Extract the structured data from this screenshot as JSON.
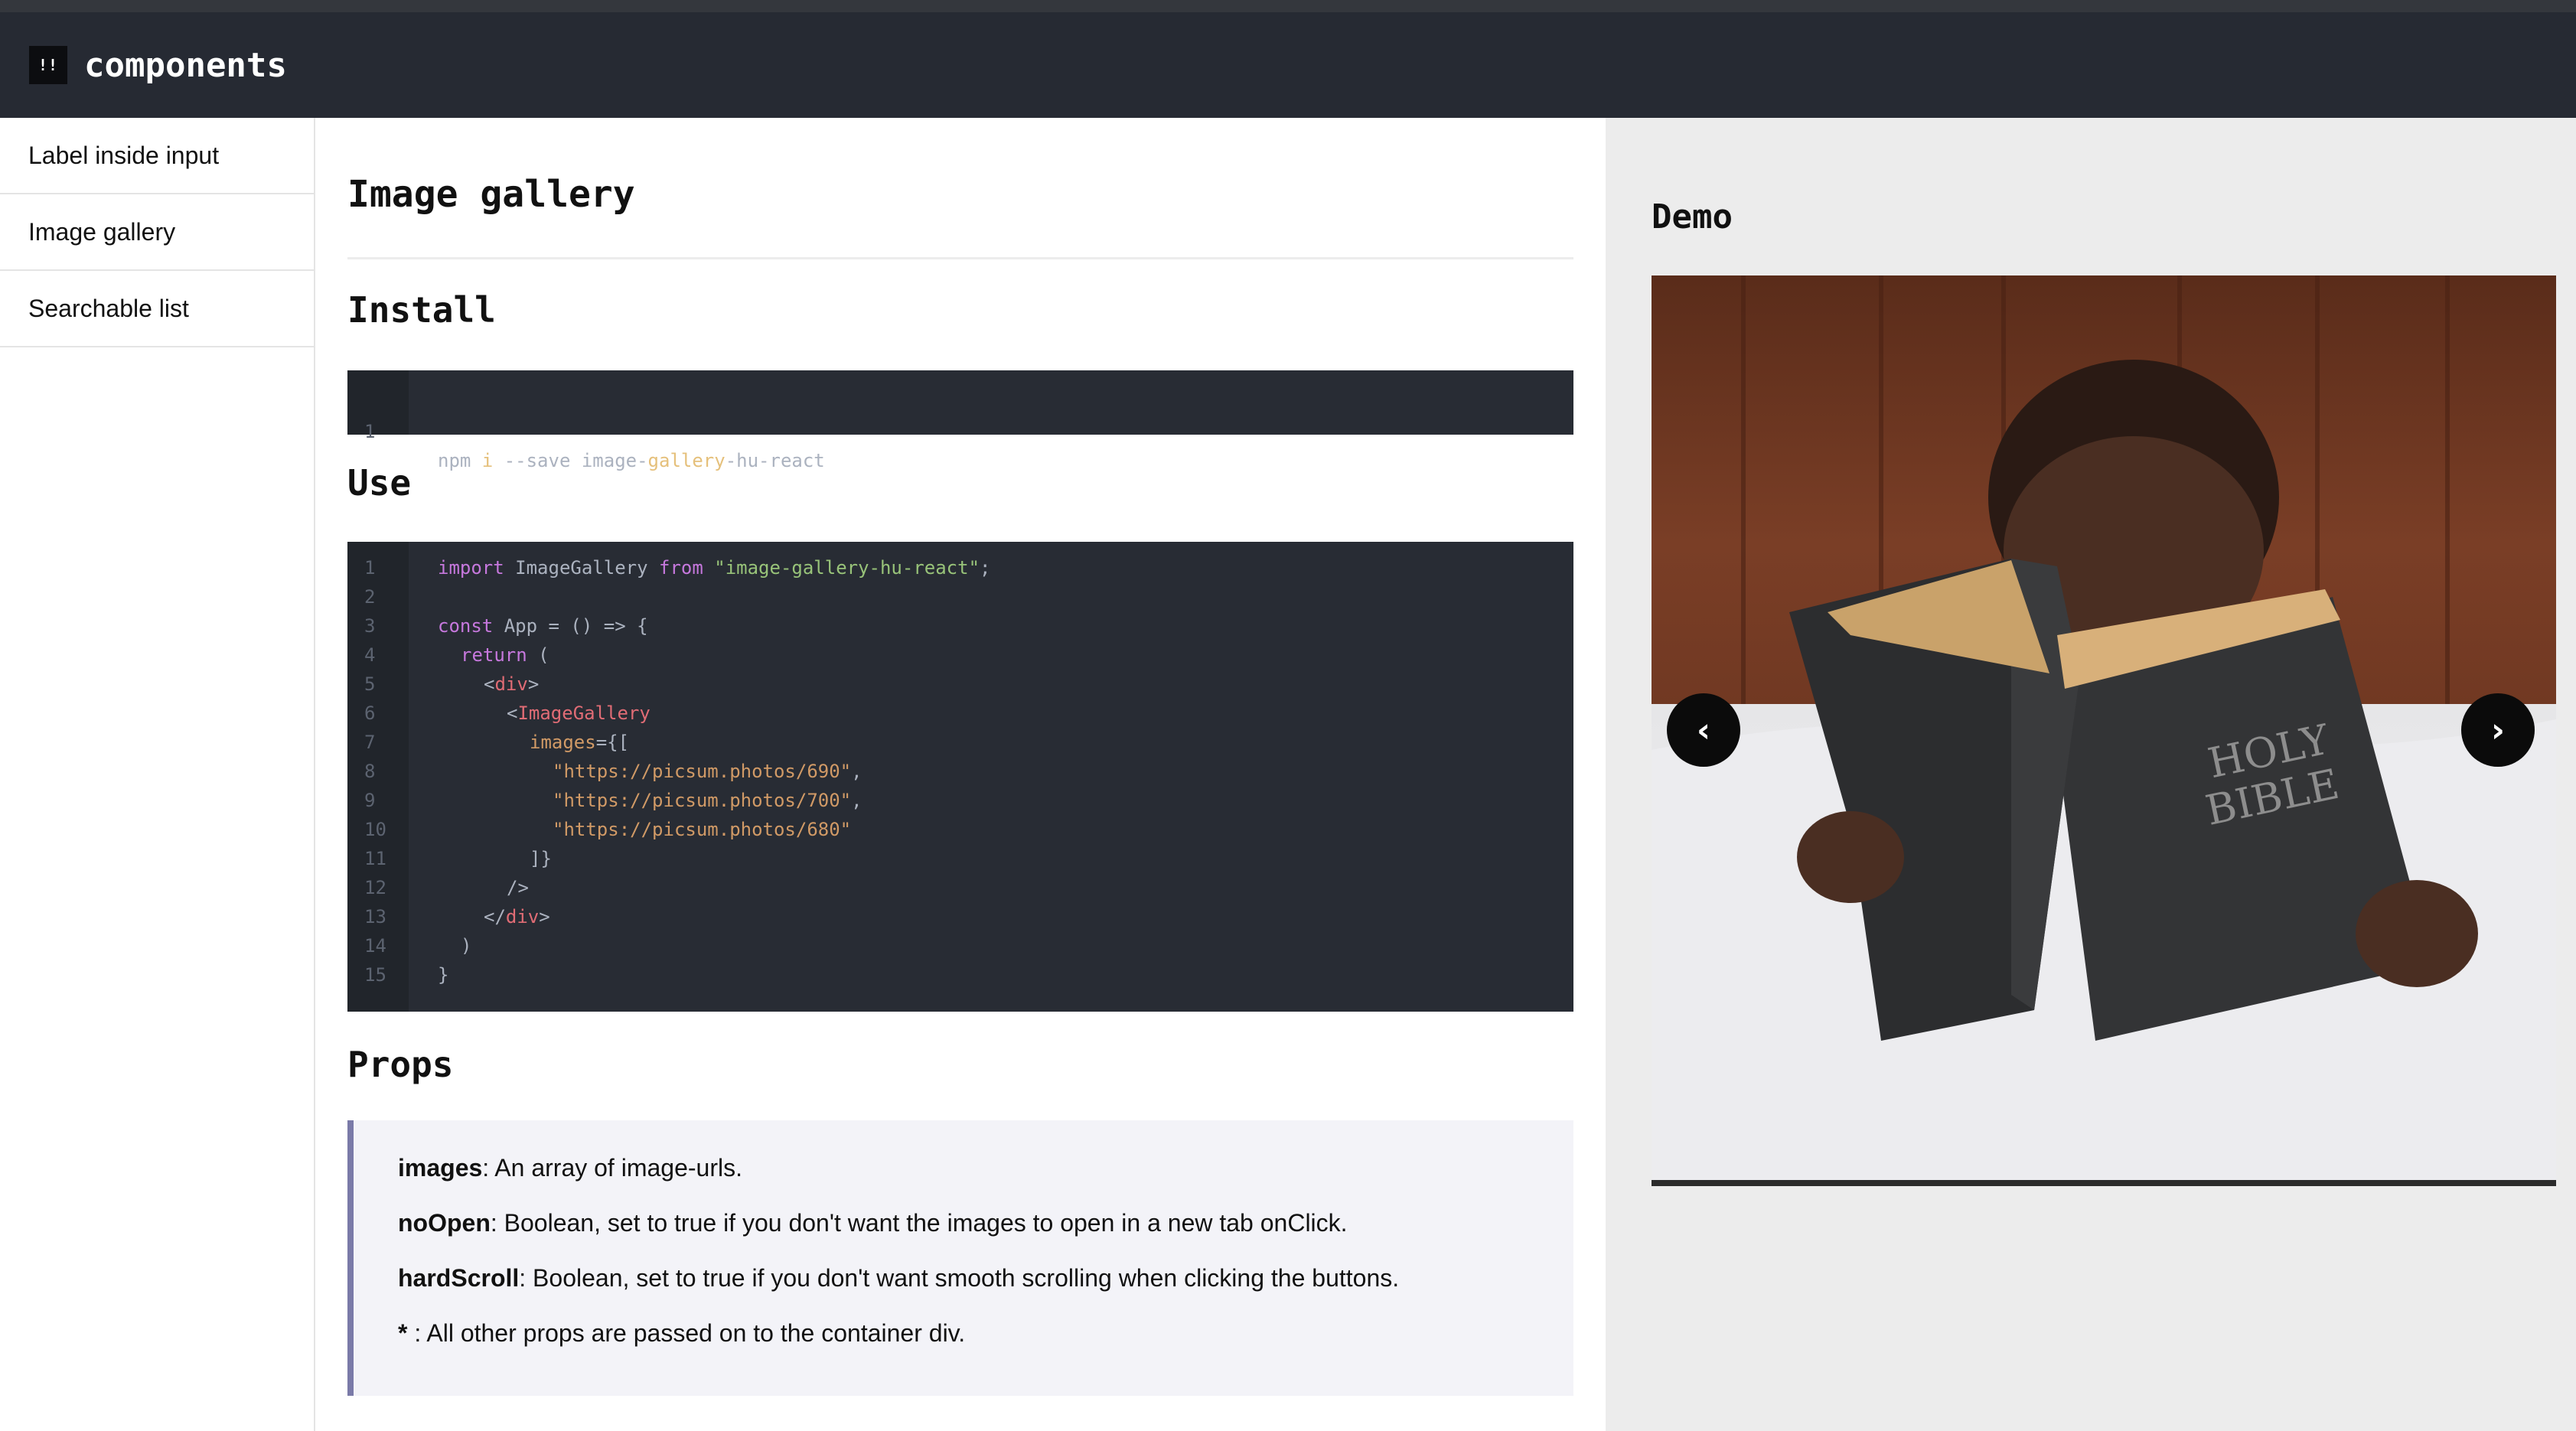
{
  "header": {
    "logo_text": "!!",
    "brand": "components"
  },
  "sidebar": {
    "items": [
      {
        "label": "Label inside input"
      },
      {
        "label": "Image gallery"
      },
      {
        "label": "Searchable list"
      }
    ]
  },
  "main": {
    "title": "Image gallery",
    "install_heading": "Install",
    "install_code": {
      "line_number": "1",
      "prefix": "npm ",
      "flag": "i",
      "middle": " --save image-",
      "highlight": "gallery",
      "suffix": "-hu-react"
    },
    "use_heading": "Use",
    "use_code_line_numbers": [
      "1",
      "2",
      "3",
      "4",
      "5",
      "6",
      "7",
      "8",
      "9",
      "10",
      "11",
      "12",
      "13",
      "14",
      "15"
    ],
    "use_code": {
      "l1_kw1": "import",
      "l1_name": " ImageGallery ",
      "l1_kw2": "from",
      "l1_str": " \"image-gallery-hu-react\"",
      "l1_end": ";",
      "l3_kw": "const",
      "l3_rest": " App = () => {",
      "l4_kw": "return",
      "l4_rest": " (",
      "l5_open": "<",
      "l5_tag": "div",
      "l5_close": ">",
      "l6_open": "<",
      "l6_tag": "ImageGallery",
      "l7_attr": "images",
      "l7_rest": "={[",
      "l8": "\"https://picsum.photos/690\"",
      "l8_end": ",",
      "l9": "\"https://picsum.photos/700\"",
      "l9_end": ",",
      "l10": "\"https://picsum.photos/680\"",
      "l11": "]}",
      "l12": "/>",
      "l13_open": "</",
      "l13_tag": "div",
      "l13_close": ">",
      "l14": ")",
      "l15": "}"
    },
    "props_heading": "Props",
    "props": [
      {
        "name": "images",
        "desc": ": An array of image-urls."
      },
      {
        "name": "noOpen",
        "desc": ": Boolean, set to true if you don't want the images to open in a new tab onClick."
      },
      {
        "name": "hardScroll",
        "desc": ": Boolean, set to true if you don't want smooth scrolling when clicking the buttons."
      },
      {
        "name": "*",
        "desc": " : All other props are passed on to the container div."
      }
    ]
  },
  "demo": {
    "title": "Demo",
    "prev_label": "‹",
    "next_label": "›",
    "image_text_line1": "HOLY",
    "image_text_line2": "BIBLE"
  },
  "colors": {
    "header_bg": "#262a33",
    "code_bg": "#282c34",
    "props_border": "#7a7aa8",
    "demo_bg": "#ececec"
  }
}
